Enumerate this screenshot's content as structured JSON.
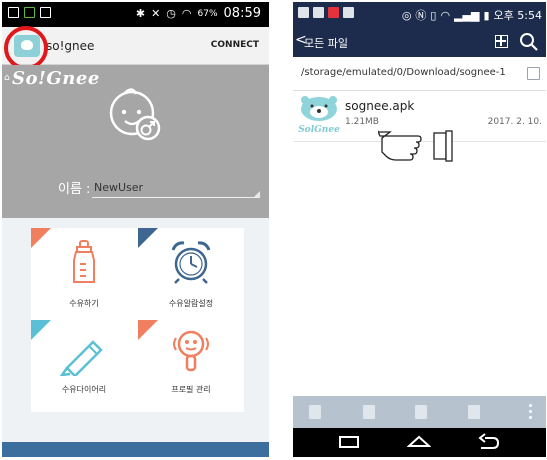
{
  "left_screen": {
    "status_bar": {
      "time": "08:59",
      "battery": "67%"
    },
    "app_bar": {
      "title": "so!gnee",
      "connect_label": "CONNECT"
    },
    "profile": {
      "logo": "So!Gnee",
      "name_label": "이름 :",
      "name_value": "NewUser"
    },
    "menu": [
      {
        "label": "수유하기",
        "icon": "baby-bottle-icon",
        "corner_color": "#f07f5f"
      },
      {
        "label": "수유알람설정",
        "icon": "alarm-clock-icon",
        "corner_color": "#3e6690"
      },
      {
        "label": "수유다이어리",
        "icon": "pencil-icon",
        "corner_color": "#5bc0d6"
      },
      {
        "label": "프로필 관리",
        "icon": "rattle-icon",
        "corner_color": "#f07f5f"
      }
    ],
    "colors": {
      "accent_orange": "#f07f5f",
      "accent_blue": "#3e6690",
      "accent_teal": "#5bc0d6",
      "highlight_red": "#e0171b"
    }
  },
  "right_screen": {
    "status_bar": {
      "time": "오후 5:54"
    },
    "app_bar": {
      "back": "<",
      "title": "모든 파일"
    },
    "path": "/storage/emulated/0/Download/sognee-1",
    "files": [
      {
        "name": "sognee.apk",
        "size": "1.21MB",
        "date": "2017. 2. 10.",
        "icon_text": "SolGnee"
      }
    ],
    "colors": {
      "header_bg": "#1d2c4d",
      "toolbar_bg": "#b6c3cf"
    }
  }
}
